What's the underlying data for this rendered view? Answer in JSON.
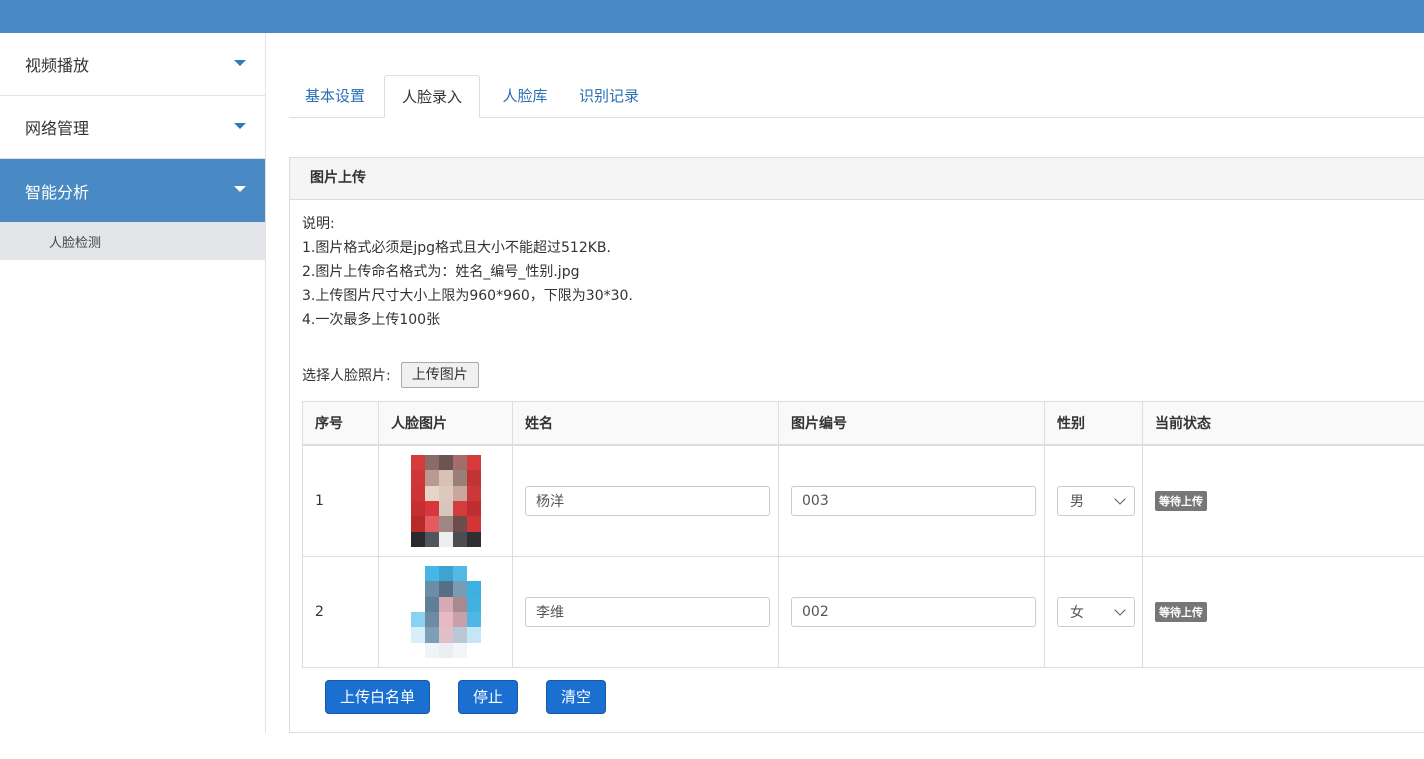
{
  "sidebar": {
    "items": [
      {
        "label": "视频播放"
      },
      {
        "label": "网络管理"
      },
      {
        "label": "智能分析"
      }
    ],
    "sub_items": [
      {
        "label": "人脸检测"
      }
    ]
  },
  "tabs": [
    {
      "label": "基本设置"
    },
    {
      "label": "人脸录入"
    },
    {
      "label": "人脸库"
    },
    {
      "label": "识别记录"
    }
  ],
  "panel": {
    "title": "图片上传",
    "notes": [
      "说明:",
      "1.图片格式必须是jpg格式且大小不能超过512KB.",
      "2.图片上传命名格式为：姓名_编号_性别.jpg",
      "3.上传图片尺寸大小上限为960*960，下限为30*30.",
      "4.一次最多上传100张"
    ],
    "choose_label": "选择人脸照片:",
    "upload_button": "上传图片"
  },
  "table": {
    "headers": [
      "序号",
      "人脸图片",
      "姓名",
      "图片编号",
      "性别",
      "当前状态"
    ],
    "rows": [
      {
        "index": "1",
        "name": "杨洋",
        "code": "003",
        "gender": "男",
        "status": "等待上传"
      },
      {
        "index": "2",
        "name": "李维",
        "code": "002",
        "gender": "女",
        "status": "等待上传"
      }
    ]
  },
  "actions": {
    "upload_whitelist": "上传白名单",
    "stop": "停止",
    "clear": "清空"
  },
  "colors": {
    "topbar": "#4a8ac4",
    "accent": "#1a6fd1",
    "badge": "#777777"
  }
}
